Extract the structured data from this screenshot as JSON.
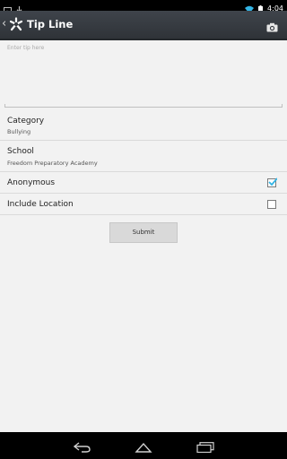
{
  "status_bar": {
    "time": "4:04",
    "left_icons": [
      "image-icon",
      "download-icon"
    ],
    "right_icons": [
      "wifi-icon",
      "battery-icon"
    ]
  },
  "action_bar": {
    "title": "Tip Line",
    "up_icon": "chevron-left-icon",
    "logo_icon": "app-logo-icon",
    "camera_icon": "camera-icon"
  },
  "form": {
    "tip_placeholder": "Enter tip here",
    "category": {
      "label": "Category",
      "value": "Bullying"
    },
    "school": {
      "label": "School",
      "value": "Freedom Preparatory Academy"
    },
    "anonymous": {
      "label": "Anonymous",
      "checked": true
    },
    "include_location": {
      "label": "Include Location",
      "checked": false
    },
    "submit_label": "Submit"
  },
  "nav_bar": {
    "icons": [
      "back-icon",
      "home-icon",
      "recents-icon"
    ]
  },
  "colors": {
    "action_bar": "#363a40",
    "background": "#f2f2f2",
    "accent": "#33b5e5"
  }
}
